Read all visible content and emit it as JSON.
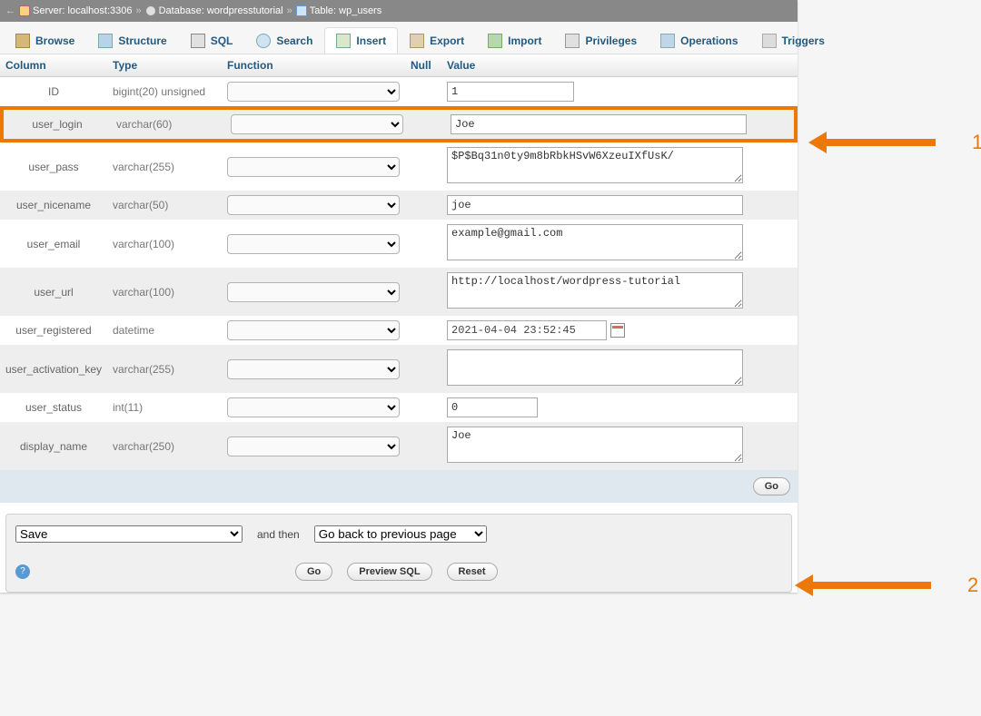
{
  "breadcrumb": {
    "back": "←",
    "server_label": "Server:",
    "server_value": "localhost:3306",
    "db_label": "Database:",
    "db_value": "wordpresstutorial",
    "table_label": "Table:",
    "table_value": "wp_users"
  },
  "tabs": [
    {
      "icon": "ic-browse",
      "label": "Browse",
      "active": false
    },
    {
      "icon": "ic-struct",
      "label": "Structure",
      "active": false
    },
    {
      "icon": "ic-sql",
      "label": "SQL",
      "active": false
    },
    {
      "icon": "ic-search",
      "label": "Search",
      "active": false
    },
    {
      "icon": "ic-insert",
      "label": "Insert",
      "active": true
    },
    {
      "icon": "ic-export",
      "label": "Export",
      "active": false
    },
    {
      "icon": "ic-import",
      "label": "Import",
      "active": false
    },
    {
      "icon": "ic-priv",
      "label": "Privileges",
      "active": false
    },
    {
      "icon": "ic-ops",
      "label": "Operations",
      "active": false
    },
    {
      "icon": "ic-trig",
      "label": "Triggers",
      "active": false
    }
  ],
  "headers": {
    "column": "Column",
    "type": "Type",
    "function": "Function",
    "null": "Null",
    "value": "Value"
  },
  "rows": [
    {
      "band": false,
      "col": "ID",
      "type": "bigint(20) unsigned",
      "input": "text",
      "value": "1",
      "size": "sm"
    },
    {
      "band": true,
      "highlight": true,
      "col": "user_login",
      "type": "varchar(60)",
      "input": "text",
      "value": "Joe",
      "size": "wide"
    },
    {
      "band": false,
      "col": "user_pass",
      "type": "varchar(255)",
      "input": "textarea",
      "value": "$P$Bq31n0ty9m8bRbkHSvW6XzeuIXfUsK/"
    },
    {
      "band": true,
      "col": "user_nicename",
      "type": "varchar(50)",
      "input": "text",
      "value": "joe",
      "size": "wide"
    },
    {
      "band": false,
      "col": "user_email",
      "type": "varchar(100)",
      "input": "textarea",
      "value": "example@gmail.com"
    },
    {
      "band": true,
      "col": "user_url",
      "type": "varchar(100)",
      "input": "textarea",
      "value": "http://localhost/wordpress-tutorial"
    },
    {
      "band": false,
      "col": "user_registered",
      "type": "datetime",
      "input": "datetime",
      "value": "2021-04-04 23:52:45"
    },
    {
      "band": true,
      "col": "user_activation_key",
      "type": "varchar(255)",
      "input": "textarea",
      "value": ""
    },
    {
      "band": false,
      "col": "user_status",
      "type": "int(11)",
      "input": "text",
      "value": "0",
      "size": "tiny"
    },
    {
      "band": true,
      "col": "display_name",
      "type": "varchar(250)",
      "input": "textarea",
      "value": "Joe"
    }
  ],
  "go_label": "Go",
  "bottom": {
    "save_option": "Save",
    "andthen": "and then",
    "back_option": "Go back to previous page",
    "go": "Go",
    "preview": "Preview SQL",
    "reset": "Reset"
  },
  "annot": {
    "one": "1",
    "two": "2"
  }
}
